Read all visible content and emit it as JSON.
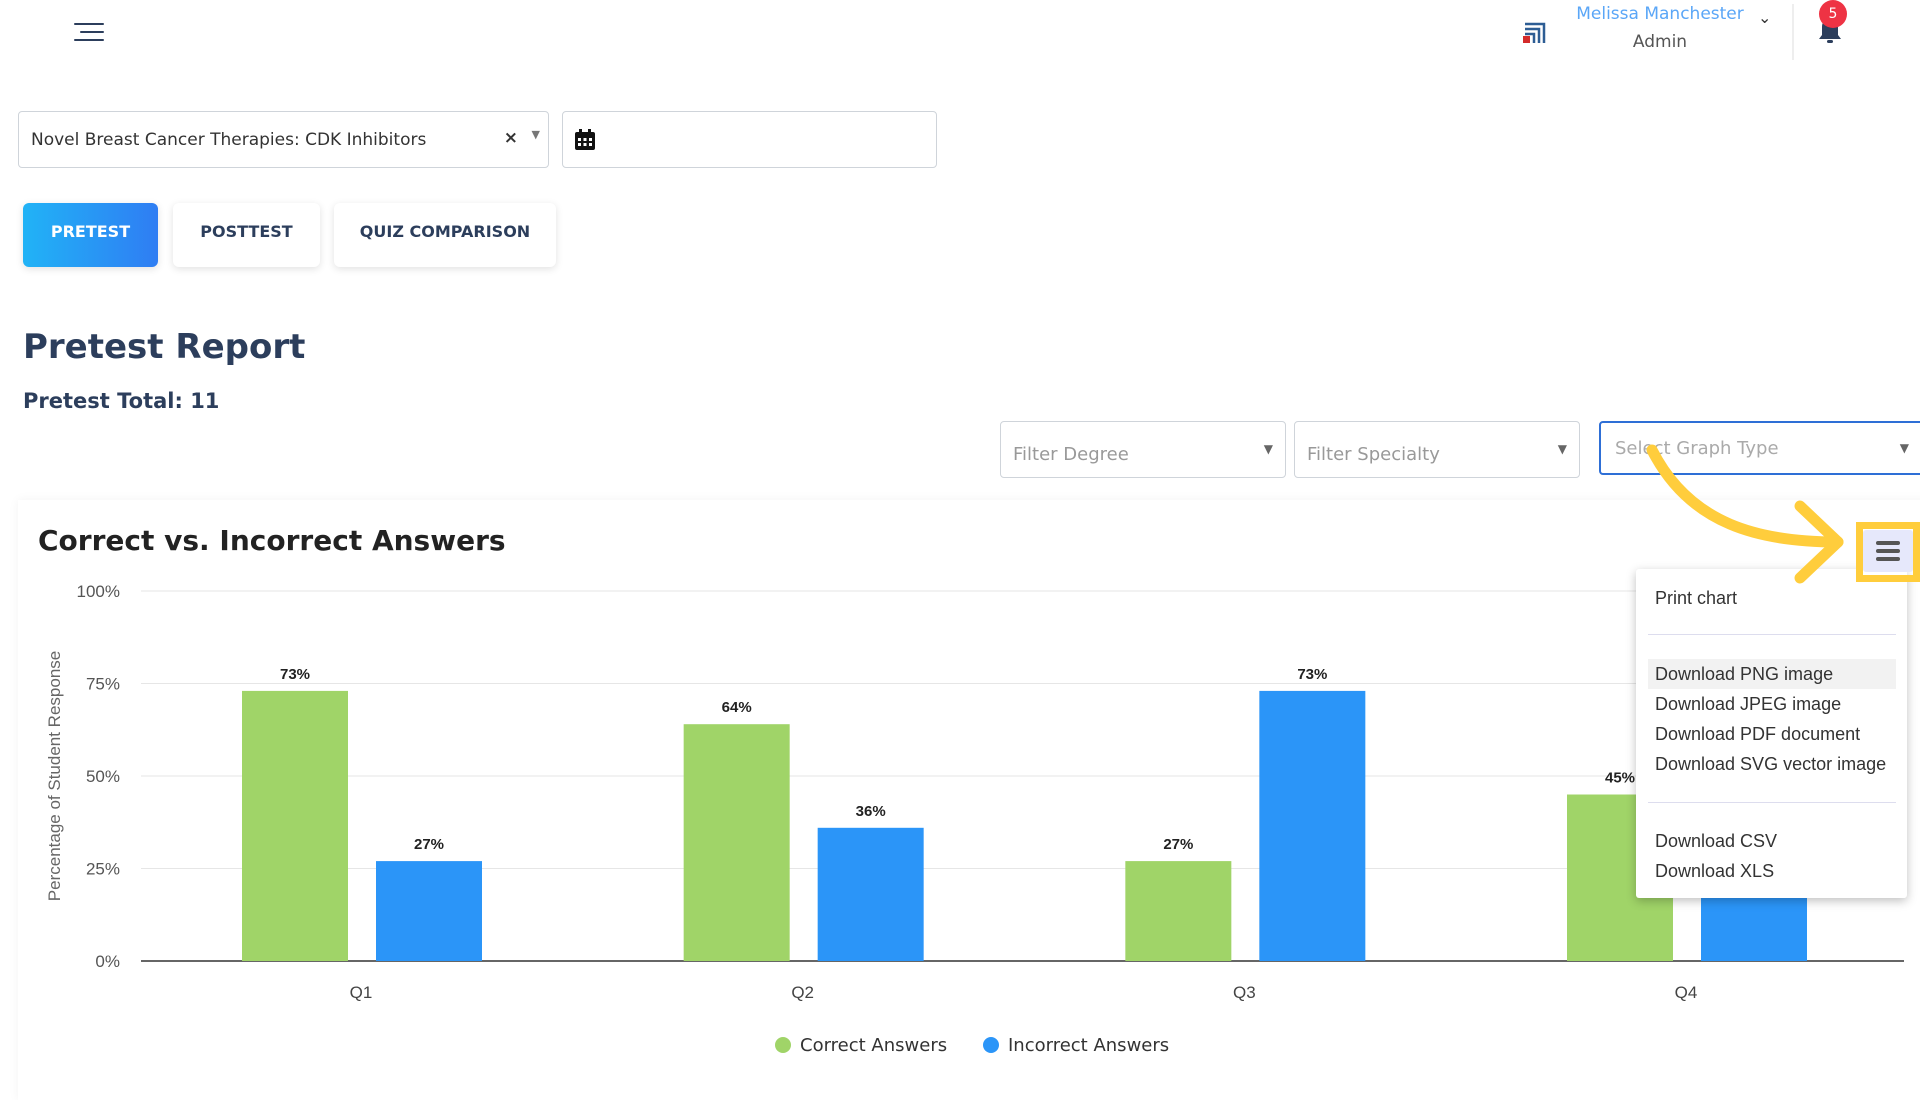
{
  "header": {
    "user_name": "Melissa Manchester",
    "user_role": "Admin",
    "notifications": "5"
  },
  "course_select": {
    "value": "Novel Breast Cancer Therapies: CDK Inhibitors",
    "clear": "×"
  },
  "tabs": [
    {
      "label": "PRETEST",
      "active": true
    },
    {
      "label": "POSTTEST"
    },
    {
      "label": "QUIZ COMPARISON"
    }
  ],
  "report": {
    "title": "Pretest Report",
    "total": "Pretest Total: 11"
  },
  "filters": {
    "degree": "Filter Degree",
    "specialty": "Filter Specialty",
    "graph_type": "Select Graph Type"
  },
  "export_menu": {
    "items": [
      "Print chart",
      "Download PNG image",
      "Download JPEG image",
      "Download PDF document",
      "Download SVG vector image",
      "Download CSV",
      "Download XLS"
    ]
  },
  "colors": {
    "correct": "#a0d468",
    "incorrect": "#2b95f8",
    "accent": "#2e7df3",
    "annotation": "#ffcd3c"
  },
  "chart_data": {
    "type": "bar",
    "title": "Correct vs. Incorrect Answers",
    "ylabel": "Percentage of Student Response",
    "xlabel": "",
    "categories": [
      "Q1",
      "Q2",
      "Q3",
      "Q4"
    ],
    "ylim": [
      0,
      100
    ],
    "yticks": [
      "0%",
      "25%",
      "50%",
      "75%",
      "100%"
    ],
    "grid": true,
    "legend": "bottom",
    "series": [
      {
        "name": "Correct Answers",
        "values": [
          73,
          64,
          27,
          45
        ],
        "labels": [
          "73%",
          "64%",
          "27%",
          "45%"
        ]
      },
      {
        "name": "Incorrect Answers",
        "values": [
          27,
          36,
          73,
          55
        ],
        "labels": [
          "27%",
          "36%",
          "73%",
          "55%"
        ]
      }
    ]
  }
}
